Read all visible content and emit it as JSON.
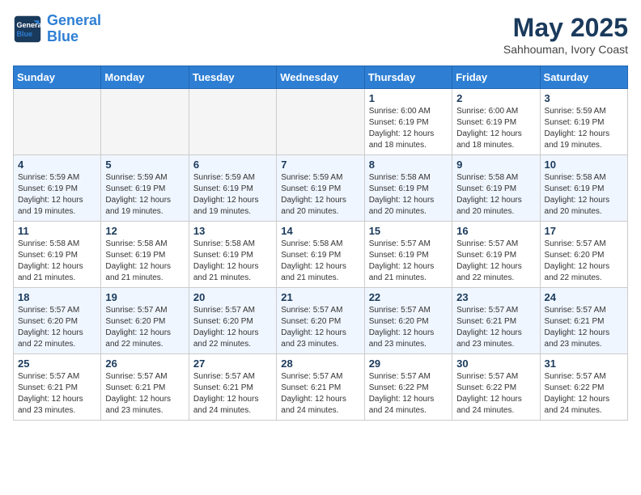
{
  "header": {
    "logo_line1": "General",
    "logo_line2": "Blue",
    "month": "May 2025",
    "location": "Sahhouman, Ivory Coast"
  },
  "weekdays": [
    "Sunday",
    "Monday",
    "Tuesday",
    "Wednesday",
    "Thursday",
    "Friday",
    "Saturday"
  ],
  "weeks": [
    [
      {
        "day": "",
        "text": ""
      },
      {
        "day": "",
        "text": ""
      },
      {
        "day": "",
        "text": ""
      },
      {
        "day": "",
        "text": ""
      },
      {
        "day": "1",
        "text": "Sunrise: 6:00 AM\nSunset: 6:19 PM\nDaylight: 12 hours\nand 18 minutes."
      },
      {
        "day": "2",
        "text": "Sunrise: 6:00 AM\nSunset: 6:19 PM\nDaylight: 12 hours\nand 18 minutes."
      },
      {
        "day": "3",
        "text": "Sunrise: 5:59 AM\nSunset: 6:19 PM\nDaylight: 12 hours\nand 19 minutes."
      }
    ],
    [
      {
        "day": "4",
        "text": "Sunrise: 5:59 AM\nSunset: 6:19 PM\nDaylight: 12 hours\nand 19 minutes."
      },
      {
        "day": "5",
        "text": "Sunrise: 5:59 AM\nSunset: 6:19 PM\nDaylight: 12 hours\nand 19 minutes."
      },
      {
        "day": "6",
        "text": "Sunrise: 5:59 AM\nSunset: 6:19 PM\nDaylight: 12 hours\nand 19 minutes."
      },
      {
        "day": "7",
        "text": "Sunrise: 5:59 AM\nSunset: 6:19 PM\nDaylight: 12 hours\nand 20 minutes."
      },
      {
        "day": "8",
        "text": "Sunrise: 5:58 AM\nSunset: 6:19 PM\nDaylight: 12 hours\nand 20 minutes."
      },
      {
        "day": "9",
        "text": "Sunrise: 5:58 AM\nSunset: 6:19 PM\nDaylight: 12 hours\nand 20 minutes."
      },
      {
        "day": "10",
        "text": "Sunrise: 5:58 AM\nSunset: 6:19 PM\nDaylight: 12 hours\nand 20 minutes."
      }
    ],
    [
      {
        "day": "11",
        "text": "Sunrise: 5:58 AM\nSunset: 6:19 PM\nDaylight: 12 hours\nand 21 minutes."
      },
      {
        "day": "12",
        "text": "Sunrise: 5:58 AM\nSunset: 6:19 PM\nDaylight: 12 hours\nand 21 minutes."
      },
      {
        "day": "13",
        "text": "Sunrise: 5:58 AM\nSunset: 6:19 PM\nDaylight: 12 hours\nand 21 minutes."
      },
      {
        "day": "14",
        "text": "Sunrise: 5:58 AM\nSunset: 6:19 PM\nDaylight: 12 hours\nand 21 minutes."
      },
      {
        "day": "15",
        "text": "Sunrise: 5:57 AM\nSunset: 6:19 PM\nDaylight: 12 hours\nand 21 minutes."
      },
      {
        "day": "16",
        "text": "Sunrise: 5:57 AM\nSunset: 6:19 PM\nDaylight: 12 hours\nand 22 minutes."
      },
      {
        "day": "17",
        "text": "Sunrise: 5:57 AM\nSunset: 6:20 PM\nDaylight: 12 hours\nand 22 minutes."
      }
    ],
    [
      {
        "day": "18",
        "text": "Sunrise: 5:57 AM\nSunset: 6:20 PM\nDaylight: 12 hours\nand 22 minutes."
      },
      {
        "day": "19",
        "text": "Sunrise: 5:57 AM\nSunset: 6:20 PM\nDaylight: 12 hours\nand 22 minutes."
      },
      {
        "day": "20",
        "text": "Sunrise: 5:57 AM\nSunset: 6:20 PM\nDaylight: 12 hours\nand 22 minutes."
      },
      {
        "day": "21",
        "text": "Sunrise: 5:57 AM\nSunset: 6:20 PM\nDaylight: 12 hours\nand 23 minutes."
      },
      {
        "day": "22",
        "text": "Sunrise: 5:57 AM\nSunset: 6:20 PM\nDaylight: 12 hours\nand 23 minutes."
      },
      {
        "day": "23",
        "text": "Sunrise: 5:57 AM\nSunset: 6:21 PM\nDaylight: 12 hours\nand 23 minutes."
      },
      {
        "day": "24",
        "text": "Sunrise: 5:57 AM\nSunset: 6:21 PM\nDaylight: 12 hours\nand 23 minutes."
      }
    ],
    [
      {
        "day": "25",
        "text": "Sunrise: 5:57 AM\nSunset: 6:21 PM\nDaylight: 12 hours\nand 23 minutes."
      },
      {
        "day": "26",
        "text": "Sunrise: 5:57 AM\nSunset: 6:21 PM\nDaylight: 12 hours\nand 23 minutes."
      },
      {
        "day": "27",
        "text": "Sunrise: 5:57 AM\nSunset: 6:21 PM\nDaylight: 12 hours\nand 24 minutes."
      },
      {
        "day": "28",
        "text": "Sunrise: 5:57 AM\nSunset: 6:21 PM\nDaylight: 12 hours\nand 24 minutes."
      },
      {
        "day": "29",
        "text": "Sunrise: 5:57 AM\nSunset: 6:22 PM\nDaylight: 12 hours\nand 24 minutes."
      },
      {
        "day": "30",
        "text": "Sunrise: 5:57 AM\nSunset: 6:22 PM\nDaylight: 12 hours\nand 24 minutes."
      },
      {
        "day": "31",
        "text": "Sunrise: 5:57 AM\nSunset: 6:22 PM\nDaylight: 12 hours\nand 24 minutes."
      }
    ]
  ]
}
